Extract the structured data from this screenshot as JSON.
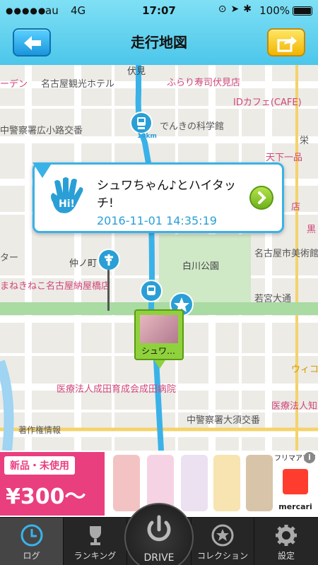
{
  "status": {
    "carrier": "au",
    "network": "4G",
    "time": "17:07",
    "battery": "100%"
  },
  "nav": {
    "title": "走行地図",
    "back_icon": "arrow-left-icon",
    "share_icon": "share-icon"
  },
  "map": {
    "labels": {
      "fushimi_top": "伏見",
      "kanko_hotel": "名古屋観光ホテル",
      "den": "ーデン",
      "furari": "ふらり寿司伏見店",
      "id_cafe": "IDカフェ(CAFE)",
      "koban": "中警察署広小路交番",
      "denki": "でんきの科学館",
      "sakae": "栄",
      "tenka": "天下一品",
      "ten": "店",
      "kuro": "黒",
      "nakanocho": "仲ノ町",
      "shirakawa": "白川公園",
      "museum": "名古屋市美術館",
      "tar": "ター",
      "maneki": "まねきねこ名古屋納屋橋店",
      "wakamiya": "若宮大通",
      "wico": "ウィコ",
      "clinic": "医療法人成田育成会成田病院",
      "clinic2": "医療法人知泉会",
      "osu": "中警察署大須交番",
      "copyright": "著作権情報"
    },
    "marker_icons": [
      "bus-marker-icon",
      "info-marker-icon",
      "train-marker-icon",
      "star-marker-icon"
    ],
    "photo_caption": "シュワ…",
    "marker_10km": "10km"
  },
  "popup": {
    "icon": "hi-hand-icon",
    "text": "シュワちゃん♪とハイタッチ!",
    "time": "2016-11-01 14:35:19"
  },
  "ad": {
    "tag": "新品・未使用",
    "price": "¥300～",
    "brand": "mercari",
    "brand_top": "フリマアプリ"
  },
  "tabs": {
    "log": "ログ",
    "ranking": "ランキング",
    "drive": "DRIVE",
    "collection": "コレクション",
    "settings": "設定"
  },
  "colors": {
    "nav": "#4cc6ea",
    "route": "#3ab2e8",
    "ad_pink": "#e93f7f",
    "tabbar": "#262626"
  }
}
